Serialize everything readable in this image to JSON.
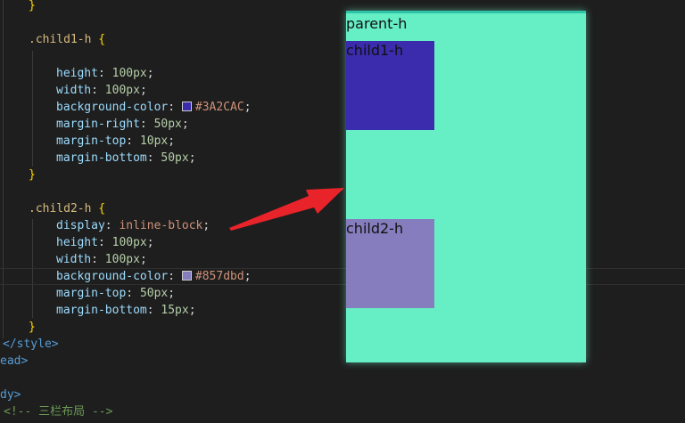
{
  "code": {
    "brace_close_1": "}",
    "child1_selector": ".child1-h",
    "open_brace": "{",
    "close_brace": "}",
    "child1_props": [
      {
        "prop": "height",
        "value": "100px"
      },
      {
        "prop": "width",
        "value": "100px"
      },
      {
        "prop": "background-color",
        "value": "#3A2CAC",
        "swatch": "#3A2CAC"
      },
      {
        "prop": "margin-right",
        "value": "50px"
      },
      {
        "prop": "margin-top",
        "value": "10px"
      },
      {
        "prop": "margin-bottom",
        "value": "50px"
      }
    ],
    "child2_selector": ".child2-h",
    "child2_props": [
      {
        "prop": "display",
        "value": "inline-block"
      },
      {
        "prop": "height",
        "value": "100px"
      },
      {
        "prop": "width",
        "value": "100px"
      },
      {
        "prop": "background-color",
        "value": "#857dbd",
        "swatch": "#857dbd"
      },
      {
        "prop": "margin-top",
        "value": "50px"
      },
      {
        "prop": "margin-bottom",
        "value": "15px"
      }
    ],
    "style_close": "</style>",
    "head_close": "ead>",
    "body_frag": "dy>",
    "comment": "<!-- 三栏布局 -->"
  },
  "preview": {
    "parent_label": "parent-h",
    "child1_label": "child1-h",
    "child2_label": "child2-h",
    "parent_color": "#66eec4",
    "child1_color": "#3A2CAC",
    "child2_color": "#857dbd"
  },
  "annotation": {
    "icon": "red-arrow-icon",
    "color": "#e8232a"
  }
}
